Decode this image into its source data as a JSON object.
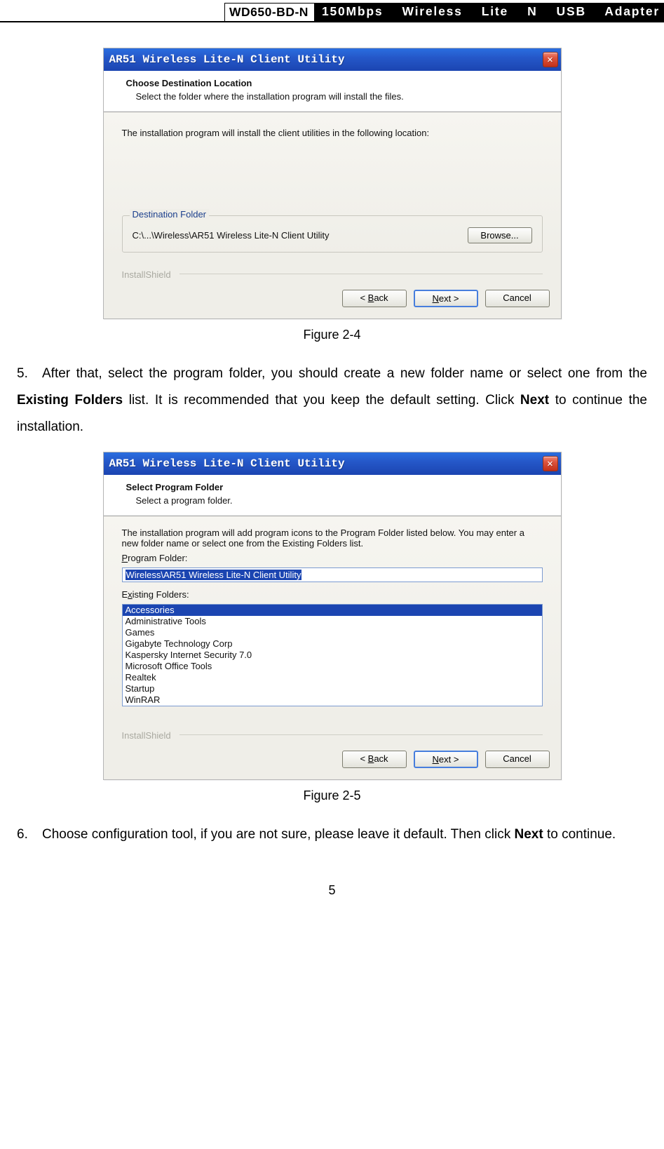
{
  "header": {
    "model": "WD650-BD-N",
    "product": "150Mbps Wireless Lite N USB Adapter"
  },
  "dialog1": {
    "title": "AR51 Wireless Lite-N Client Utility",
    "banner_title": "Choose Destination Location",
    "banner_sub": "Select the folder where the installation program will install the files.",
    "body_line": "The installation program will install the client utilities in the following location:",
    "group_legend": "Destination Folder",
    "path": "C:\\...\\Wireless\\AR51 Wireless Lite-N Client Utility",
    "browse": "Browse...",
    "brand": "InstallShield",
    "buttons": {
      "back": "< Back",
      "next": "Next >",
      "cancel": "Cancel"
    }
  },
  "fig1_caption": "Figure 2-4",
  "para5": {
    "num": "5.",
    "text_before": "After that, select the program folder, you should create a new folder name or select one from the ",
    "bold1": "Existing Folders",
    "text_mid": " list. It is recommended that you keep the default setting. Click ",
    "bold2": "Next",
    "text_after": " to continue the installation."
  },
  "dialog2": {
    "title": "AR51 Wireless Lite-N Client Utility",
    "banner_title": "Select Program Folder",
    "banner_sub": "Select a program folder.",
    "body_line": "The installation program will add program icons to the Program Folder listed below. You may enter a new folder name or select one from the Existing Folders list.",
    "label_pf": "Program Folder:",
    "pf_value": "Wireless\\AR51 Wireless Lite-N Client Utility",
    "label_ef": "Existing Folders:",
    "folders": [
      "Accessories",
      "Administrative Tools",
      "Games",
      "Gigabyte Technology Corp",
      "Kaspersky Internet Security 7.0",
      "Microsoft Office Tools",
      "Realtek",
      "Startup",
      "WinRAR"
    ],
    "brand": "InstallShield",
    "buttons": {
      "back": "< Back",
      "next": "Next >",
      "cancel": "Cancel"
    }
  },
  "fig2_caption": "Figure 2-5",
  "para6": {
    "num": "6.",
    "text_before": "Choose configuration tool, if you are not sure, please leave it default. Then click ",
    "bold1": "Next",
    "text_after": " to continue."
  },
  "page_number": "5"
}
